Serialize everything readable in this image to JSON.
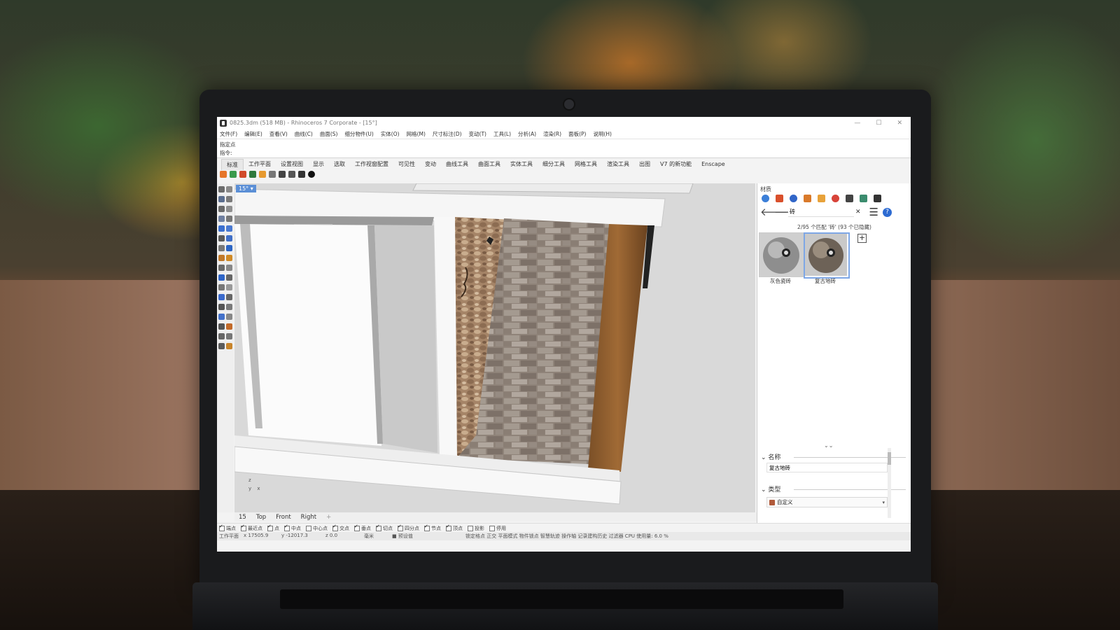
{
  "window": {
    "title": "0825.3dm (518 MB) - Rhinoceros 7 Corporate - [15°]",
    "controls": [
      "—",
      "☐",
      "✕"
    ]
  },
  "menu": [
    "文件(F)",
    "编辑(E)",
    "查看(V)",
    "曲线(C)",
    "曲面(S)",
    "细分物件(U)",
    "实体(O)",
    "网格(M)",
    "尺寸标注(D)",
    "变动(T)",
    "工具(L)",
    "分析(A)",
    "渲染(R)",
    "面板(P)",
    "说明(H)"
  ],
  "command": {
    "history": "指定点",
    "prompt": "指令:",
    "value": ""
  },
  "tabs": [
    "标准",
    "工作平面",
    "设置视图",
    "显示",
    "选取",
    "工作视窗配置",
    "可见性",
    "变动",
    "曲线工具",
    "曲面工具",
    "实体工具",
    "细分工具",
    "网格工具",
    "渲染工具",
    "出图",
    "V7 的新功能",
    "Enscape"
  ],
  "viewport": {
    "tag": "15°",
    "tag_arrow": "▾",
    "axis_z": "z",
    "axis_y": "y",
    "axis_x": "x"
  },
  "view_tabs": [
    "15",
    "Top",
    "Front",
    "Right",
    "+"
  ],
  "osnaps": [
    {
      "label": "端点",
      "on": true
    },
    {
      "label": "最近点",
      "on": true
    },
    {
      "label": "点",
      "on": true
    },
    {
      "label": "中点",
      "on": true
    },
    {
      "label": "中心点",
      "on": false
    },
    {
      "label": "交点",
      "on": true
    },
    {
      "label": "垂点",
      "on": true
    },
    {
      "label": "切点",
      "on": true
    },
    {
      "label": "四分点",
      "on": true
    },
    {
      "label": "节点",
      "on": true
    },
    {
      "label": "顶点",
      "on": true
    },
    {
      "label": "投影",
      "on": false
    },
    {
      "label": "停用",
      "on": false
    }
  ],
  "status": {
    "plane": "工作平面",
    "x": "x 17505.9",
    "y": "y -12017.3",
    "z": "z 0.0",
    "unit": "毫米",
    "layer": "■ 预设值",
    "flags": "锁定格点  正交  平面模式  物件锁点  智慧轨迹  操作轴  记录建构历史  过滤器  CPU 使用量: 6.0 %"
  },
  "panel": {
    "title": "材质",
    "search": "砖",
    "clear": "✕",
    "back": "🡐",
    "forward": "🡒",
    "menu": "☰",
    "help": "?",
    "match_count": "2/95 个匹配 '砖' (93 个已隐藏)",
    "plus": "+",
    "chevron": "⌄⌄",
    "materials": [
      {
        "name": "灰色瓷砖"
      },
      {
        "name": "复古地砖"
      }
    ],
    "name_section": "名称",
    "name_value": "复古地砖",
    "type_section": "类型",
    "type_value": "自定义",
    "caret": "⌄",
    "select_caret": "▾"
  },
  "colors": {
    "accent": "#5b8fd6",
    "help_blue": "#2d6bd2"
  }
}
